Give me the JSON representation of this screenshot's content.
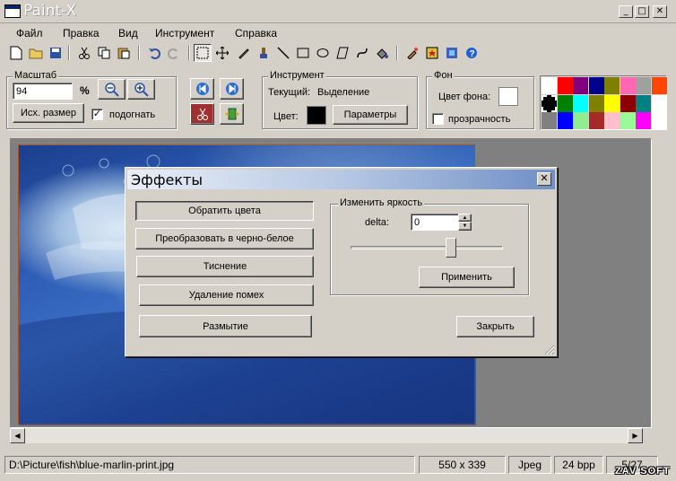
{
  "window": {
    "title": "Paint-X",
    "min_glyph": "_",
    "max_glyph": "□",
    "close_glyph": "✕"
  },
  "menu": {
    "file": "Файл",
    "edit": "Правка",
    "view": "Вид",
    "tool": "Инструмент",
    "help": "Справка"
  },
  "zoom": {
    "group_label": "Масштаб",
    "value": "94",
    "unit": "%",
    "original_size_button": "Исх. размер",
    "fit_label": "подогнать",
    "fit_checked": true,
    "zoom_out_glyph": "🔍-",
    "zoom_in_glyph": "🔍+"
  },
  "tool": {
    "group_label": "Инструмент",
    "current_label": "Текущий:",
    "current_value": "Выделение",
    "color_label": "Цвет:",
    "color_value": "#000000",
    "params_button": "Параметры"
  },
  "background": {
    "group_label": "Фон",
    "color_label": "Цвет фона:",
    "color_value": "#ffffff",
    "transparency_label": "прозрачность",
    "transparency_checked": false
  },
  "palette": {
    "colors": [
      "#ffffff",
      "#ff0000",
      "#800080",
      "#00008b",
      "#808000",
      "#ff69b4",
      "#a0a0a0",
      "#ff4500",
      "#000000",
      "#008000",
      "#00ffff",
      "#808000",
      "#ffff00",
      "#8b0000",
      "#008080",
      "#ffffff",
      "#808080",
      "#0000ff",
      "#90ee90",
      "#a52a2a",
      "#ffc0cb",
      "#98fb98",
      "#ff00ff",
      "#ffffff"
    ]
  },
  "dialog": {
    "title": "Эффекты",
    "invert_button": "Обратить цвета",
    "grayscale_button": "Преобразовать в черно-белое",
    "emboss_button": "Тиснение",
    "denoise_button": "Удаление помех",
    "blur_button": "Размытие",
    "brightness_group": "Изменить яркость",
    "delta_label": "delta:",
    "delta_value": "0",
    "apply_button": "Применить",
    "close_button": "Закрыть",
    "brightness_slider_fraction": 0.5
  },
  "status": {
    "path": "D:\\Picture\\fish\\blue-marlin-print.jpg",
    "dimensions": "550 x 339",
    "format": "Jpeg",
    "bpp": "24 bpp",
    "index": "5/27"
  },
  "watermark": "ZAV SOFT"
}
